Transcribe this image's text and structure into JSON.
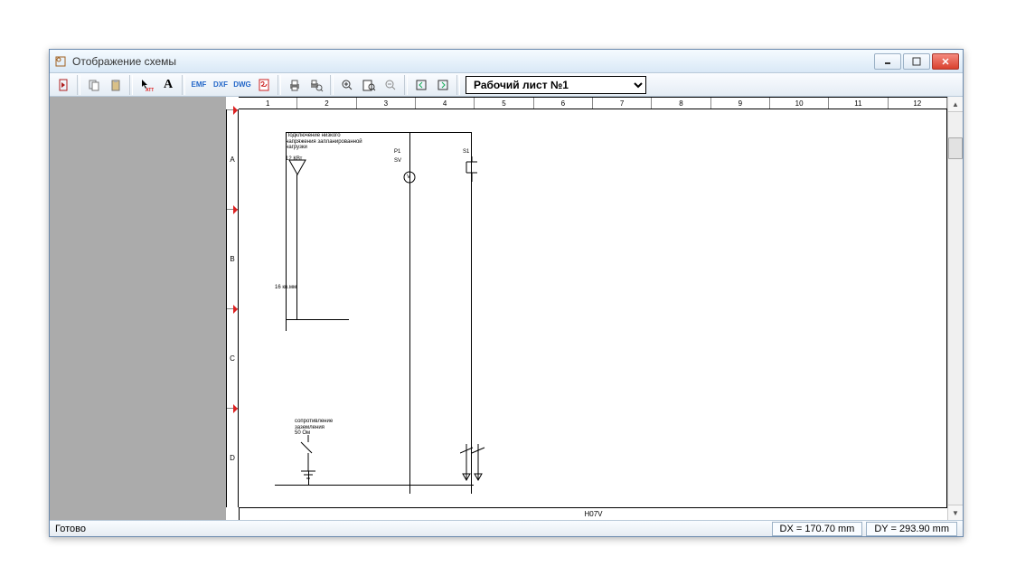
{
  "title": "Отображение схемы",
  "toolbar": {
    "exit_label": "",
    "copy_label": "",
    "paste_label": "",
    "cursor_att": "ATT",
    "text_A": "A",
    "emf": "EMF",
    "dxf": "DXF",
    "dwg": "DWG",
    "pdf": ""
  },
  "sheet_selector": {
    "selected": "Рабочий лист №1"
  },
  "ruler": {
    "cols": [
      "1",
      "2",
      "3",
      "4",
      "5",
      "6",
      "7",
      "8",
      "9",
      "10",
      "11",
      "12"
    ],
    "rows": [
      "A",
      "B",
      "C",
      "D"
    ]
  },
  "drawingside_mark_rows": [
    0,
    1,
    2,
    3,
    4
  ],
  "schematic": {
    "note1": "Подключение низкого\nнапряжения запланированной\nнагрузки",
    "power": "12 КВт",
    "wire": "16 кв.мм",
    "p1": "P1",
    "sv": "SV",
    "s1": "S1",
    "vlabel": "V",
    "gnd_note": "сопротивление\nзаземления\n50 Ом",
    "bottom_label": "H07V"
  },
  "status": {
    "ready": "Готово",
    "dx": "DX = 170.70 mm",
    "dy": "DY = 293.90 mm"
  }
}
